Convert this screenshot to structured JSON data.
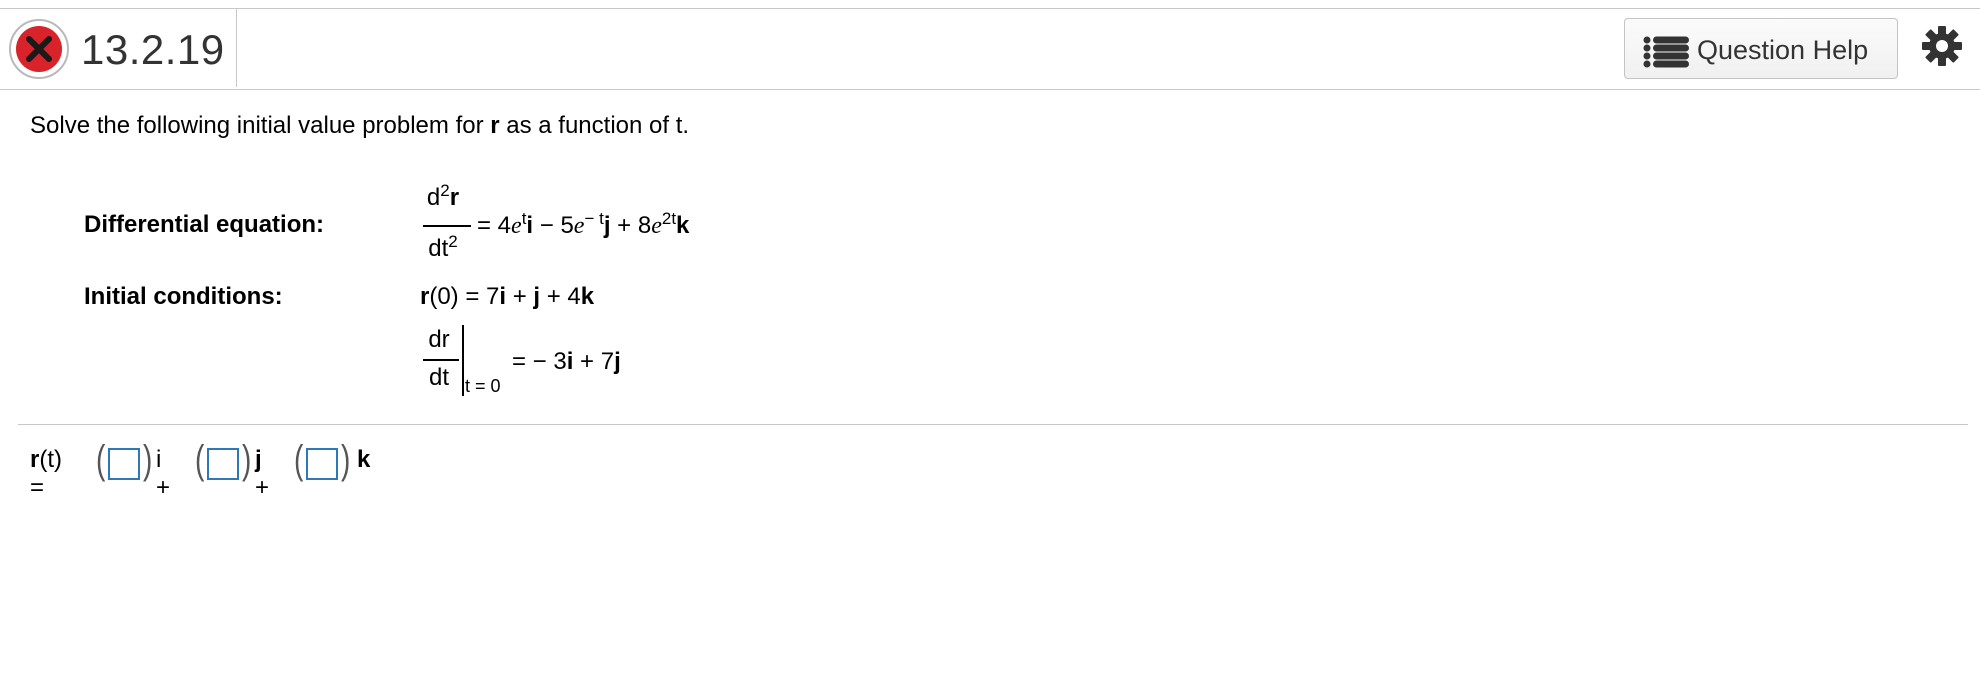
{
  "header": {
    "question_number": "13.2.19",
    "status_icon": "incorrect-x-icon",
    "help_button_label": "Question Help",
    "help_icon": "list-icon",
    "settings_icon": "gear-icon"
  },
  "problem": {
    "prompt_before": "Solve the following initial value problem for ",
    "prompt_bold": "r",
    "prompt_after": " as a function of t.",
    "diff_eq_label": "Differential equation:",
    "init_cond_label": "Initial conditions:",
    "diff_eq": {
      "numerator_d": "d",
      "numerator_exp": "2",
      "numerator_r": "r",
      "denominator": "dt",
      "denominator_exp": "2",
      "rhs_eq": "= 4",
      "e1": "e",
      "exp1": "t",
      "i": "i",
      "minus": " − 5",
      "e2": "e",
      "exp2": "− t",
      "j": "j",
      "plus": " + 8",
      "e3": "e",
      "exp3": "2t",
      "k": "k"
    },
    "init1": {
      "r": "r",
      "mid": "(0) = 7",
      "i": "i",
      "plus1": " + ",
      "j": "j",
      "plus2": " + 4",
      "k": "k"
    },
    "init2": {
      "numerator": "dr",
      "denominator": "dt",
      "eval_at": "t = 0",
      "rhs_eq": "= − 3",
      "i": "i",
      "plus": " + 7",
      "j": "j"
    }
  },
  "answer": {
    "r": "r",
    "lhs": "(t) =",
    "open_paren": "(",
    "close_paren": ")",
    "i_suffix": "i +",
    "j_label": "j",
    "j_plus": " +",
    "k_label": "k",
    "box1_value": "",
    "box2_value": "",
    "box3_value": ""
  },
  "colors": {
    "error_red": "#d8232a",
    "input_border": "#2f78b7",
    "divider": "#c8c8c8"
  }
}
